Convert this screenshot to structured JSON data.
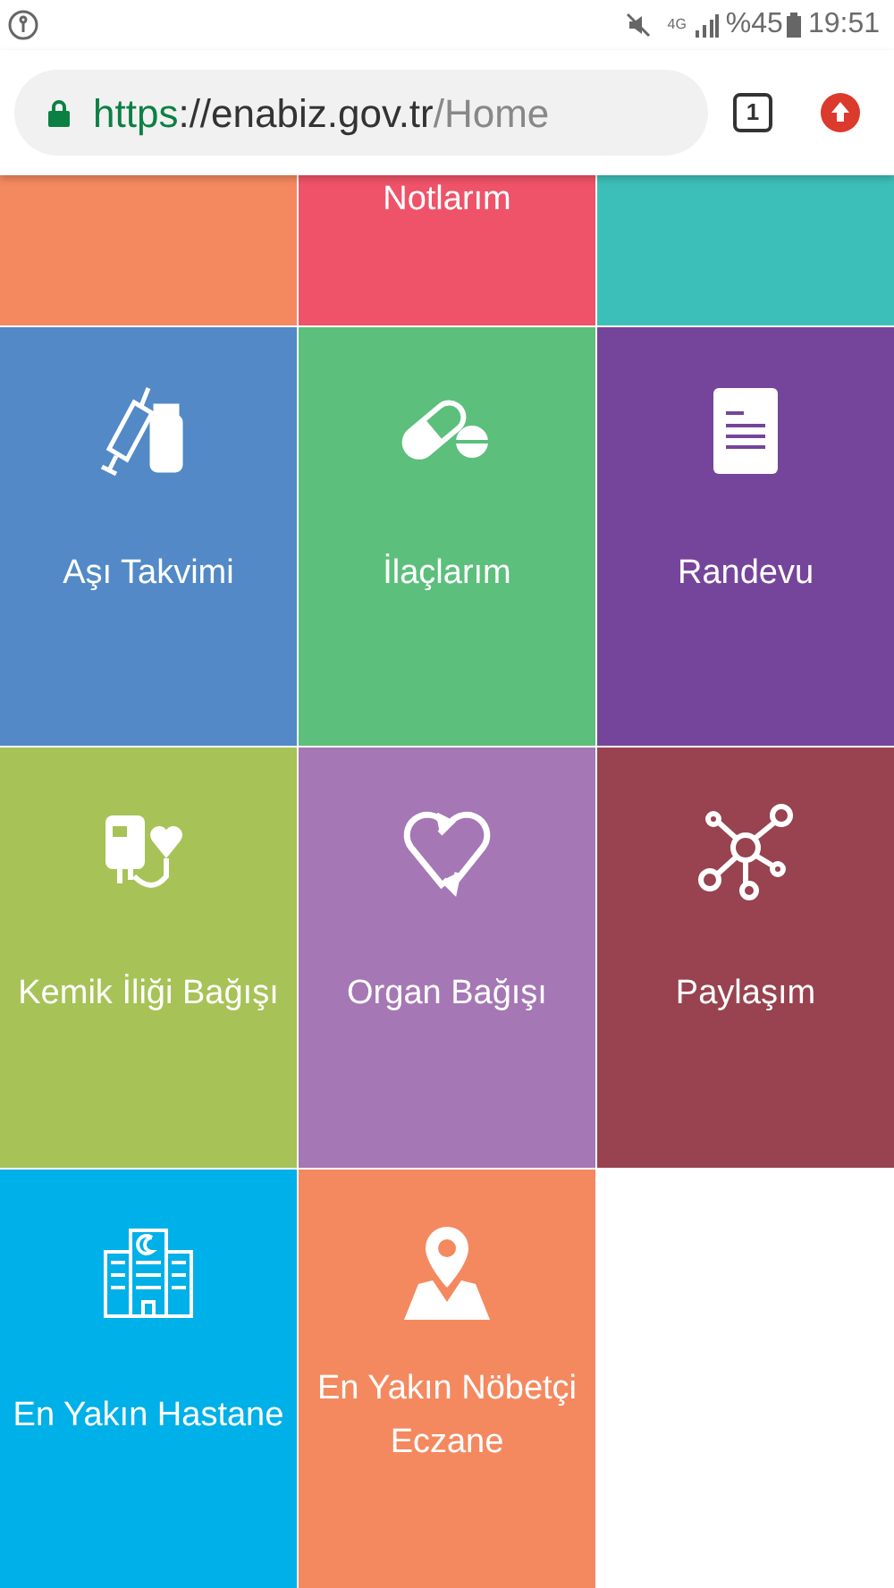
{
  "status_bar": {
    "battery": "%45",
    "time": "19:51",
    "network": "4G"
  },
  "address_bar": {
    "scheme": "https",
    "host": "://enabiz.gov.tr",
    "path": "/Home",
    "tab_count": "1"
  },
  "top_tiles": [
    {
      "color": "#f4895f"
    },
    {
      "label": "Notlarım",
      "color": "#ef5369"
    },
    {
      "color": "#3dbfb9"
    }
  ],
  "tiles": [
    {
      "label": "Aşı Takvimi",
      "color": "#5289c6"
    },
    {
      "label": "İlaçlarım",
      "color": "#5cbf7c"
    },
    {
      "label": "Randevu",
      "color": "#75449b"
    },
    {
      "label": "Kemik İliği Bağışı",
      "color": "#a7c257"
    },
    {
      "label": "Organ Bağışı",
      "color": "#a577b4"
    },
    {
      "label": "Paylaşım",
      "color": "#98434f"
    },
    {
      "label": "En Yakın Hastane",
      "color": "#00b0e8"
    },
    {
      "label": "En Yakın Nöbetçi Eczane",
      "color": "#f4895f"
    }
  ]
}
